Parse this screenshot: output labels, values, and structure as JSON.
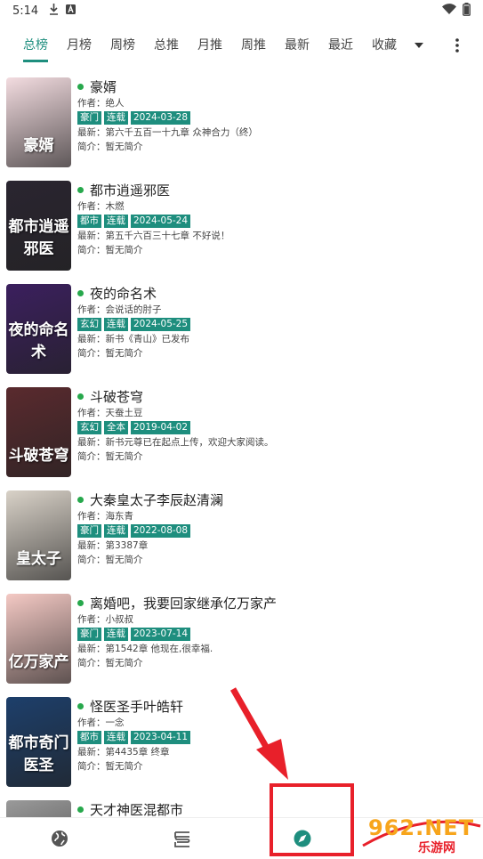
{
  "status_bar": {
    "time": "5:14",
    "icons": [
      "download-icon",
      "notification-a-icon",
      "wifi-icon",
      "battery-icon"
    ]
  },
  "tabs": {
    "items": [
      {
        "label": "总榜",
        "active": true
      },
      {
        "label": "月榜",
        "active": false
      },
      {
        "label": "周榜",
        "active": false
      },
      {
        "label": "总推",
        "active": false
      },
      {
        "label": "月推",
        "active": false
      },
      {
        "label": "周推",
        "active": false
      },
      {
        "label": "最新",
        "active": false
      },
      {
        "label": "最近",
        "active": false
      },
      {
        "label": "收藏",
        "active": false
      }
    ],
    "dropdown_icon": "triangle-down-icon",
    "more_icon": "more-vert-icon"
  },
  "books": [
    {
      "title": "豪婿",
      "author": "作者：绝人",
      "tags": [
        "豪门",
        "连载",
        "2024-03-28"
      ],
      "latest": "最新：第六千五百一十九章 众神合力（终）",
      "intro": "简介：暂无简介",
      "cover_text": "豪婿",
      "cover_color": "#f3dce0"
    },
    {
      "title": "都市逍遥邪医",
      "author": "作者：木燃",
      "tags": [
        "都市",
        "连载",
        "2024-05-24"
      ],
      "latest": "最新：第五千六百三十七章 不好说！",
      "intro": "简介：暂无简介",
      "cover_text": "都市逍遥邪医",
      "cover_color": "#2a2530"
    },
    {
      "title": "夜的命名术",
      "author": "作者：会说话的肘子",
      "tags": [
        "玄幻",
        "连载",
        "2024-05-25"
      ],
      "latest": "最新：新书《青山》已发布",
      "intro": "简介：暂无简介",
      "cover_text": "夜的命名术",
      "cover_color": "#3b1f5e"
    },
    {
      "title": "斗破苍穹",
      "author": "作者：天蚕土豆",
      "tags": [
        "玄幻",
        "全本",
        "2019-04-02"
      ],
      "latest": "最新：新书元尊已在起点上传，欢迎大家阅读。",
      "intro": "简介：暂无简介",
      "cover_text": "斗破苍穹",
      "cover_color": "#5a2a2e"
    },
    {
      "title": "大秦皇太子李辰赵清澜",
      "author": "作者：海东青",
      "tags": [
        "豪门",
        "连载",
        "2022-08-08"
      ],
      "latest": "最新：第3387章",
      "intro": "简介：暂无简介",
      "cover_text": "皇太子",
      "cover_color": "#d9d2c8"
    },
    {
      "title": "离婚吧，我要回家继承亿万家产",
      "author": "作者：小叔叔",
      "tags": [
        "豪门",
        "连载",
        "2023-07-14"
      ],
      "latest": "最新：第1542章 他现在,很幸福.",
      "intro": "简介：暂无简介",
      "cover_text": "亿万家产",
      "cover_color": "#f4c9c4"
    },
    {
      "title": "怪医圣手叶皓轩",
      "author": "作者：一念",
      "tags": [
        "都市",
        "连载",
        "2023-04-11"
      ],
      "latest": "最新：第4435章 终章",
      "intro": "简介：暂无简介",
      "cover_text": "都市奇门医圣",
      "cover_color": "#1d3f6b"
    },
    {
      "title": "天才神医混都市",
      "author": "",
      "tags": [],
      "latest": "",
      "intro": "",
      "cover_text": "",
      "cover_color": "#9a9a9a"
    }
  ],
  "bottom_nav": {
    "items": [
      "globe-icon",
      "bookshelf-icon",
      "compass-icon"
    ],
    "active_color": "#1e8e7e"
  },
  "watermark": {
    "brand": "962.NET",
    "sub": "乐游网"
  },
  "colors": {
    "accent": "#1e8e7e",
    "dot": "#27a84c",
    "highlight": "#e8202a"
  }
}
